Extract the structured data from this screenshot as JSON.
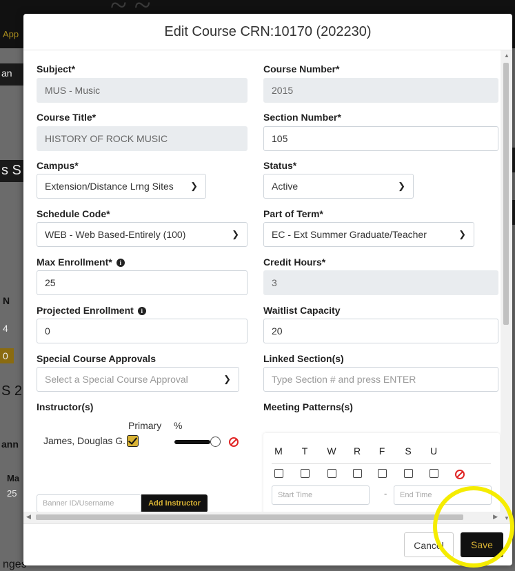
{
  "background": {
    "tab_fragment": "App",
    "fragments": [
      "an",
      "s S",
      "N",
      "4",
      "0",
      "S 2",
      "Ma",
      "25",
      "ann",
      "nges"
    ]
  },
  "modal": {
    "title": "Edit Course CRN:10170 (202230)"
  },
  "form": {
    "subject": {
      "label": "Subject*",
      "value": "MUS - Music"
    },
    "course_number": {
      "label": "Course Number*",
      "value": "2015"
    },
    "course_title": {
      "label": "Course Title*",
      "value": "HISTORY OF ROCK MUSIC"
    },
    "section_number": {
      "label": "Section Number*",
      "value": "105"
    },
    "campus": {
      "label": "Campus*",
      "value": "Extension/Distance Lrng Sites"
    },
    "status": {
      "label": "Status*",
      "value": "Active"
    },
    "schedule_code": {
      "label": "Schedule Code*",
      "value": "WEB - Web Based-Entirely (100)"
    },
    "part_of_term": {
      "label": "Part of Term*",
      "value": "EC - Ext Summer Graduate/Teacher"
    },
    "max_enrollment": {
      "label": "Max Enrollment*",
      "value": "25"
    },
    "credit_hours": {
      "label": "Credit Hours*",
      "value": "3"
    },
    "projected_enrollment": {
      "label": "Projected Enrollment",
      "value": "0"
    },
    "waitlist_capacity": {
      "label": "Waitlist Capacity",
      "value": "20"
    },
    "special_approvals": {
      "label": "Special Course Approvals",
      "placeholder": "Select a Special Course Approval"
    },
    "linked_sections": {
      "label": "Linked Section(s)",
      "placeholder": "Type Section # and press ENTER"
    }
  },
  "instructors": {
    "label": "Instructor(s)",
    "col_primary": "Primary",
    "col_percent": "%",
    "rows": [
      {
        "name": "James, Douglas G.",
        "primary": true,
        "percent": 100
      }
    ],
    "search_placeholder": "Banner ID/Username",
    "add_label": "Add Instructor"
  },
  "meeting_patterns": {
    "label": "Meeting Patterns(s)",
    "days": [
      "M",
      "T",
      "W",
      "R",
      "F",
      "S",
      "U"
    ],
    "start_placeholder": "Start Time",
    "end_placeholder": "End Time",
    "dash": "-"
  },
  "footer": {
    "cancel_label": "Cancel",
    "save_label": "Save"
  },
  "colors": {
    "accent": "#d8b234",
    "dark": "#111111",
    "delete": "#e02424",
    "highlight": "#f5ec00"
  }
}
